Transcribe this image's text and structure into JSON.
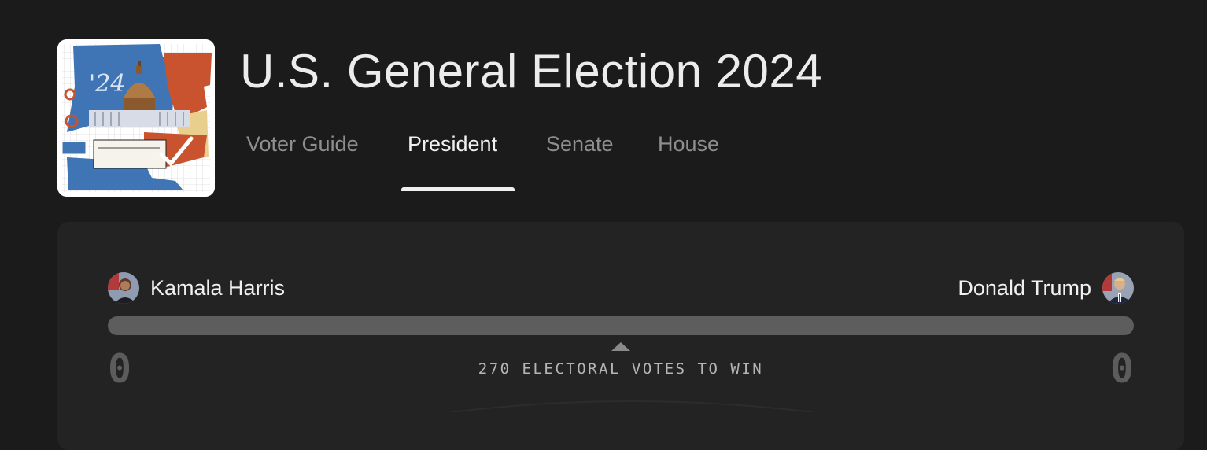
{
  "page": {
    "title": "U.S. General Election 2024"
  },
  "logo": {
    "year_text": "'24",
    "icon": "election-collage-capitol-icon"
  },
  "tabs": [
    {
      "label": "Voter Guide",
      "active": false
    },
    {
      "label": "President",
      "active": true
    },
    {
      "label": "Senate",
      "active": false
    },
    {
      "label": "House",
      "active": false
    }
  ],
  "race": {
    "left_candidate": {
      "name": "Kamala Harris",
      "electoral_votes": "0"
    },
    "right_candidate": {
      "name": "Donald Trump",
      "electoral_votes": "0"
    },
    "threshold_label": "270 ELECTORAL VOTES TO WIN",
    "progress": {
      "left_fraction": 0,
      "right_fraction": 0
    }
  },
  "colors": {
    "background": "#1b1b1b",
    "panel": "#232323",
    "bar": "#5d5d5d",
    "active_tab": "#f0f0f0",
    "inactive_tab": "#8e8e8e"
  }
}
